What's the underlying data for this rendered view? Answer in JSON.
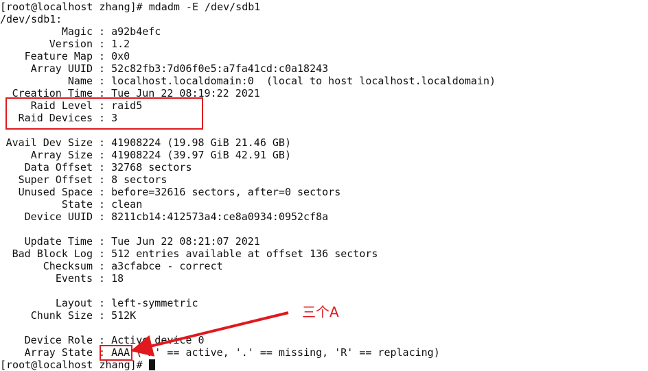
{
  "terminal": {
    "command_prompt": "[root@localhost zhang]# ",
    "command": "mdadm -E /dev/sdb1",
    "device_header": "/dev/sdb1:",
    "fields": [
      {
        "label": "Magic",
        "value": "a92b4efc"
      },
      {
        "label": "Version",
        "value": "1.2"
      },
      {
        "label": "Feature Map",
        "value": "0x0"
      },
      {
        "label": "Array UUID",
        "value": "52c82fb3:7d06f0e5:a7fa41cd:c0a18243"
      },
      {
        "label": "Name",
        "value": "localhost.localdomain:0  (local to host localhost.localdomain)"
      },
      {
        "label": "Creation Time",
        "value": "Tue Jun 22 08:19:22 2021"
      },
      {
        "label": "Raid Level",
        "value": "raid5"
      },
      {
        "label": "Raid Devices",
        "value": "3"
      },
      null,
      {
        "label": "Avail Dev Size",
        "value": "41908224 (19.98 GiB 21.46 GB)"
      },
      {
        "label": "Array Size",
        "value": "41908224 (39.97 GiB 42.91 GB)"
      },
      {
        "label": "Data Offset",
        "value": "32768 sectors"
      },
      {
        "label": "Super Offset",
        "value": "8 sectors"
      },
      {
        "label": "Unused Space",
        "value": "before=32616 sectors, after=0 sectors"
      },
      {
        "label": "State",
        "value": "clean"
      },
      {
        "label": "Device UUID",
        "value": "8211cb14:412573a4:ce8a0934:0952cf8a"
      },
      null,
      {
        "label": "Update Time",
        "value": "Tue Jun 22 08:21:07 2021"
      },
      {
        "label": "Bad Block Log",
        "value": "512 entries available at offset 136 sectors"
      },
      {
        "label": "Checksum",
        "value": "a3cfabce - correct"
      },
      {
        "label": "Events",
        "value": "18"
      },
      null,
      {
        "label": "Layout",
        "value": "left-symmetric"
      },
      {
        "label": "Chunk Size",
        "value": "512K"
      },
      null,
      {
        "label": "Device Role",
        "value": "Active device 0"
      },
      {
        "label": "Array State",
        "value": "AAA ('A' == active, '.' == missing, 'R' == replacing)"
      }
    ],
    "final_prompt": "[root@localhost zhang]# "
  },
  "annotation": {
    "note": "三个A",
    "color": "#e0191e"
  }
}
